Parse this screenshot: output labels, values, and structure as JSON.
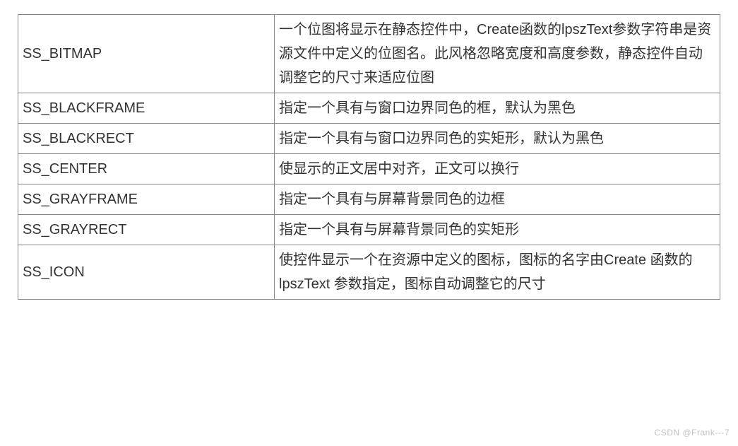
{
  "table": {
    "rows": [
      {
        "name": "SS_BITMAP",
        "desc": "一个位图将显示在静态控件中，Create函数的lpszText参数字符串是资源文件中定义的位图名。此风格忽略宽度和高度参数，静态控件自动调整它的尺寸来适应位图"
      },
      {
        "name": "SS_BLACKFRAME",
        "desc": "指定一个具有与窗口边界同色的框，默认为黑色"
      },
      {
        "name": "SS_BLACKRECT",
        "desc": "指定一个具有与窗口边界同色的实矩形，默认为黑色"
      },
      {
        "name": "SS_CENTER",
        "desc": "使显示的正文居中对齐，正文可以换行"
      },
      {
        "name": "SS_GRAYFRAME",
        "desc": "指定一个具有与屏幕背景同色的边框"
      },
      {
        "name": "SS_GRAYRECT",
        "desc": "指定一个具有与屏幕背景同色的实矩形"
      },
      {
        "name": "SS_ICON",
        "desc": "使控件显示一个在资源中定义的图标，图标的名字由Create 函数的lpszText 参数指定，图标自动调整它的尺寸"
      }
    ]
  },
  "watermark": "CSDN @Frank---7"
}
